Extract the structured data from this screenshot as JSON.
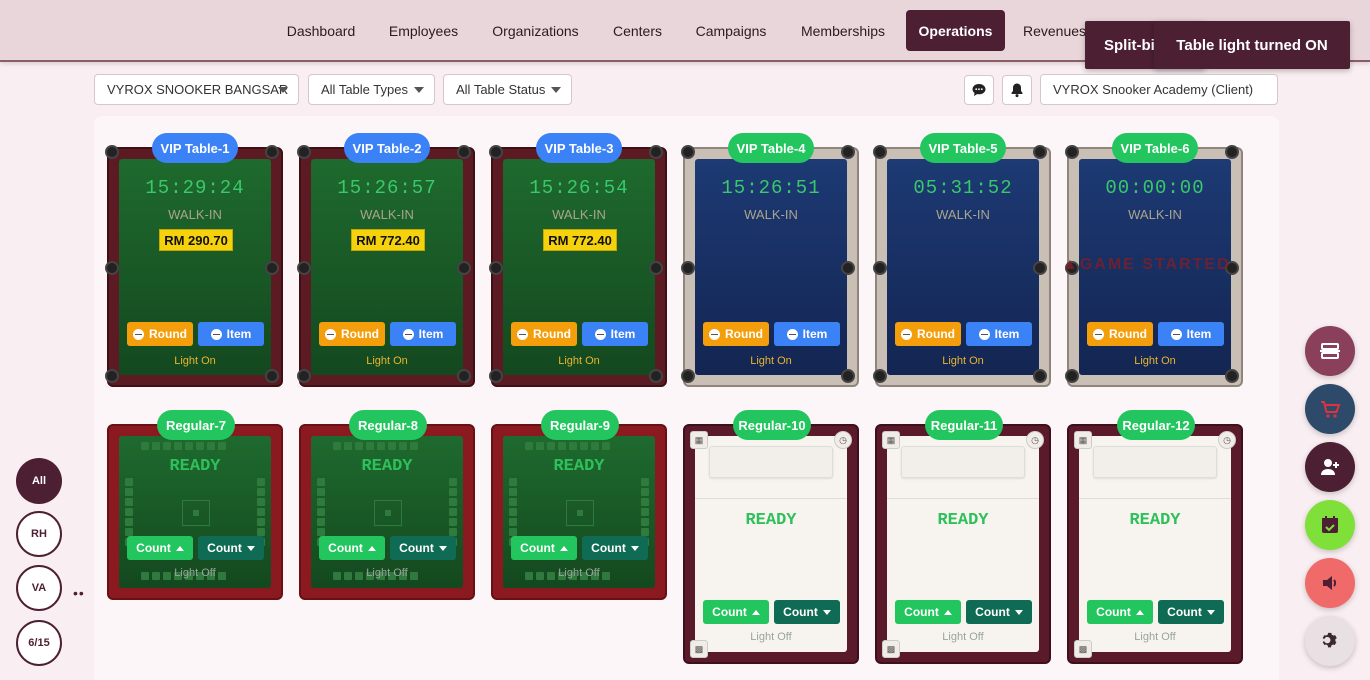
{
  "nav": {
    "items": [
      "Dashboard",
      "Employees",
      "Organizations",
      "Centers",
      "Campaigns",
      "Memberships",
      "Operations",
      "Revenues"
    ],
    "active": "Operations"
  },
  "toasts": {
    "back": "Split-bi",
    "front": "Table light turned ON"
  },
  "filters": {
    "center": "VYROX SNOOKER BANGSAR",
    "type": "All Table Types",
    "status": "All Table Status",
    "client": "VYROX Snooker Academy (Client)"
  },
  "vip_tables": [
    {
      "name": "VIP Table-1",
      "timer": "15:29:24",
      "mode": "WALK-IN",
      "price": "RM 290.70",
      "round": "Round",
      "item": "Item",
      "light": "Light On"
    },
    {
      "name": "VIP Table-2",
      "timer": "15:26:57",
      "mode": "WALK-IN",
      "price": "RM 772.40",
      "round": "Round",
      "item": "Item",
      "light": "Light On"
    },
    {
      "name": "VIP Table-3",
      "timer": "15:26:54",
      "mode": "WALK-IN",
      "price": "RM 772.40",
      "round": "Round",
      "item": "Item",
      "light": "Light On"
    },
    {
      "name": "VIP Table-4",
      "timer": "15:26:51",
      "mode": "WALK-IN",
      "price": "",
      "round": "Round",
      "item": "Item",
      "light": "Light On"
    },
    {
      "name": "VIP Table-5",
      "timer": "05:31:52",
      "mode": "WALK-IN",
      "price": "",
      "round": "Round",
      "item": "Item",
      "light": "Light On"
    },
    {
      "name": "VIP Table-6",
      "timer": "00:00:00",
      "mode": "WALK-IN",
      "price": "",
      "round": "Round",
      "item": "Item",
      "light": "Light On",
      "overlay": "GAME STARTED"
    }
  ],
  "regular_tables": [
    {
      "name": "Regular-7",
      "status": "READY",
      "count_up": "Count",
      "count_down": "Count",
      "light": "Light Off"
    },
    {
      "name": "Regular-8",
      "status": "READY",
      "count_up": "Count",
      "count_down": "Count",
      "light": "Light Off"
    },
    {
      "name": "Regular-9",
      "status": "READY",
      "count_up": "Count",
      "count_down": "Count",
      "light": "Light Off"
    },
    {
      "name": "Regular-10",
      "status": "READY",
      "count_up": "Count",
      "count_down": "Count",
      "light": "Light Off"
    },
    {
      "name": "Regular-11",
      "status": "READY",
      "count_up": "Count",
      "count_down": "Count",
      "light": "Light Off"
    },
    {
      "name": "Regular-12",
      "status": "READY",
      "count_up": "Count",
      "count_down": "Count",
      "light": "Light Off"
    }
  ],
  "sidebar": {
    "all": "All",
    "rh": "RH",
    "va": "VA",
    "count": "6/15"
  },
  "fabs": [
    "split-bill-icon",
    "cart-icon",
    "add-user-icon",
    "calendar-check-icon",
    "speaker-icon",
    "gear-icon"
  ],
  "colors": {
    "brand": "#4d1f33",
    "vip_pill": "#3b82f6",
    "regular_pill": "#22c55e",
    "ready": "#2fc05c"
  }
}
